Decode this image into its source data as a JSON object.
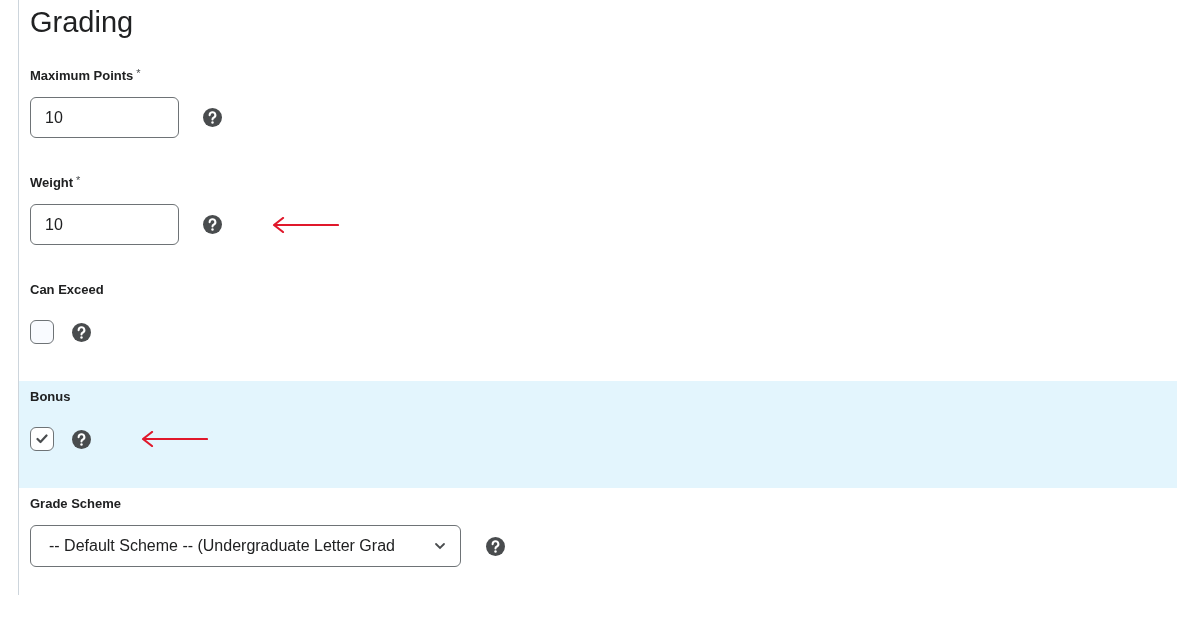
{
  "heading": "Grading",
  "fields": [
    {
      "kind": "number",
      "label": "Maximum Points",
      "required_mark": "*",
      "value": "10",
      "highlighted": false,
      "annotated": false
    },
    {
      "kind": "number",
      "label": "Weight",
      "required_mark": "*",
      "value": "10",
      "highlighted": false,
      "annotated": true
    },
    {
      "kind": "checkbox",
      "label": "Can Exceed",
      "checked": false,
      "highlighted": false,
      "annotated": false
    },
    {
      "kind": "checkbox",
      "label": "Bonus",
      "checked": true,
      "highlighted": true,
      "annotated": true
    },
    {
      "kind": "select",
      "label": "Grade Scheme",
      "value": "-- Default Scheme -- (Undergraduate Letter Grad",
      "highlighted": false,
      "annotated": false
    }
  ]
}
